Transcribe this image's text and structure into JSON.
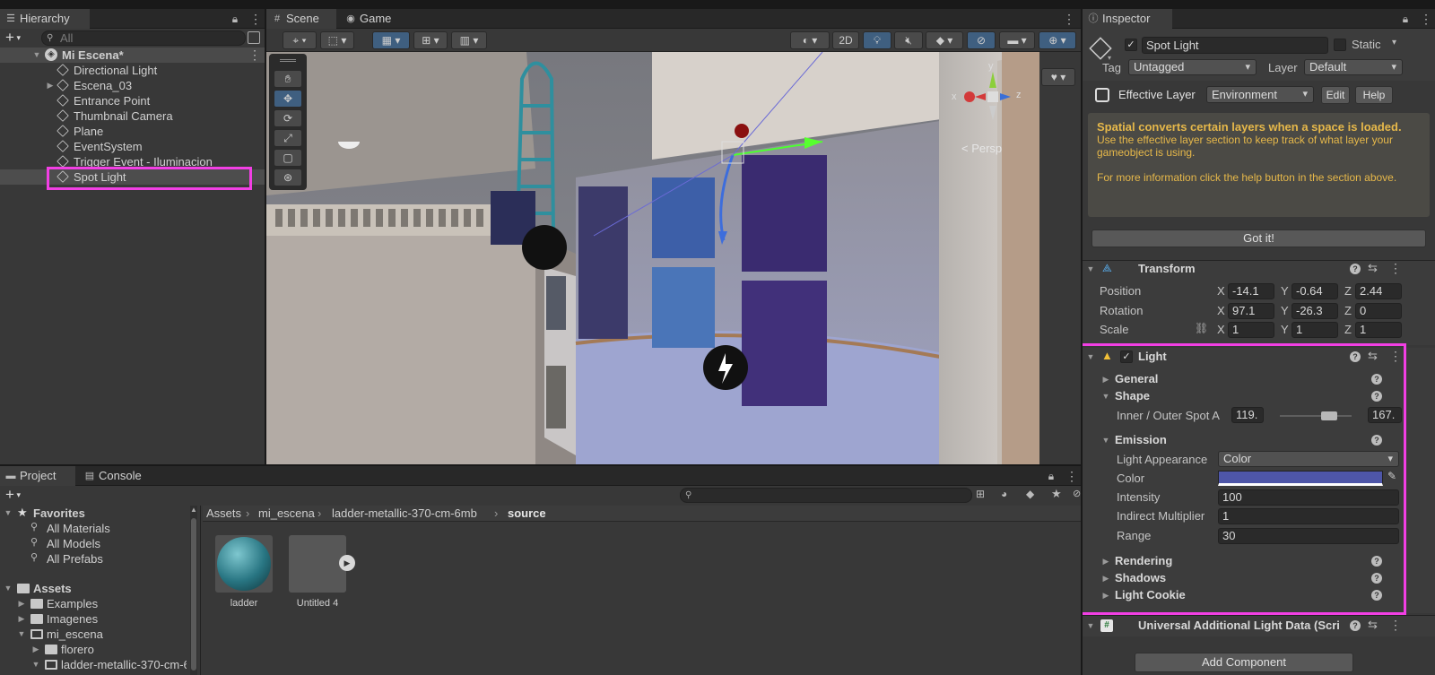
{
  "hierarchy": {
    "tab": "Hierarchy",
    "search_placeholder": "All",
    "scene_name": "Mi Escena*",
    "items": [
      {
        "label": "Directional Light"
      },
      {
        "label": "Escena_03"
      },
      {
        "label": "Entrance Point"
      },
      {
        "label": "Thumbnail Camera"
      },
      {
        "label": "Plane"
      },
      {
        "label": "EventSystem"
      },
      {
        "label": "Trigger Event - Iluminacion"
      },
      {
        "label": "Spot Light"
      }
    ]
  },
  "scene_view": {
    "tabs": [
      "Scene",
      "Game"
    ],
    "mode_2d": "2D",
    "projection": "< Persp",
    "gizmo_axes": {
      "x": "x",
      "y": "y",
      "z": "z"
    },
    "tools": [
      "hand-tool",
      "move-tool",
      "rotate-tool",
      "scale-tool",
      "rect-tool",
      "transform-tool"
    ]
  },
  "project": {
    "tabs": [
      "Project",
      "Console"
    ],
    "favorites_label": "Favorites",
    "favorites": [
      "All Materials",
      "All Models",
      "All Prefabs"
    ],
    "assets_label": "Assets",
    "assets": [
      "Examples",
      "Imagenes",
      "mi_escena",
      "florero",
      "ladder-metallic-370-cm-6mb"
    ],
    "breadcrumb": [
      "Assets",
      "mi_escena",
      "ladder-metallic-370-cm-6mb",
      "source"
    ],
    "files": [
      {
        "name": "ladder",
        "type": "material"
      },
      {
        "name": "Untitled 4",
        "type": "model"
      }
    ],
    "hidden_count": "7"
  },
  "inspector": {
    "tab": "Inspector",
    "object_name": "Spot Light",
    "static_label": "Static",
    "tag_label": "Tag",
    "tag_value": "Untagged",
    "layer_label": "Layer",
    "layer_value": "Default",
    "effective_layer_label": "Effective Layer",
    "effective_layer_value": "Environment",
    "edit_label": "Edit",
    "help_label": "Help",
    "notice_title": "Spatial converts certain layers when a space is loaded.",
    "notice_body1": "Use the effective layer section to keep track of what layer your gameobject is using.",
    "notice_body2": "For more information click the help button in the section above.",
    "gotit_label": "Got it!",
    "transform": {
      "title": "Transform",
      "position_label": "Position",
      "position": {
        "x": "-14.1",
        "y": "-0.64",
        "z": "2.44"
      },
      "rotation_label": "Rotation",
      "rotation": {
        "x": "97.1",
        "y": "-26.3",
        "z": "0"
      },
      "scale_label": "Scale",
      "scale": {
        "x": "1",
        "y": "1",
        "z": "1"
      }
    },
    "light": {
      "title": "Light",
      "general": "General",
      "shape": "Shape",
      "spot_angle_label": "Inner / Outer Spot A",
      "inner": "119.",
      "outer": "167.",
      "spot_slider_min": 0.58,
      "spot_slider_max": 0.8,
      "emission": "Emission",
      "appearance_label": "Light Appearance",
      "appearance_value": "Color",
      "color_label": "Color",
      "color_value": "#4e56a8",
      "intensity_label": "Intensity",
      "intensity_value": "100",
      "indirect_label": "Indirect Multiplier",
      "indirect_value": "1",
      "range_label": "Range",
      "range_value": "30",
      "rendering": "Rendering",
      "shadows": "Shadows",
      "cookie": "Light Cookie"
    },
    "urp_component": "Universal Additional Light Data (Scri",
    "add_component": "Add Component"
  },
  "colors": {
    "highlight": "#f23fe4",
    "accent": "#3a79bb",
    "warning_text": "#e6b84a"
  }
}
